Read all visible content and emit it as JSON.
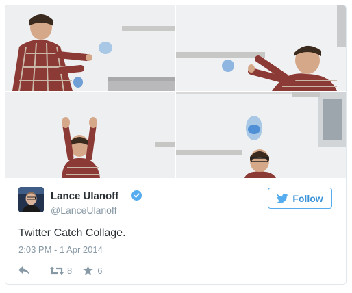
{
  "collage": {
    "photos": [
      {
        "label": "juggling-photo-1"
      },
      {
        "label": "juggling-photo-2"
      },
      {
        "label": "juggling-photo-3"
      },
      {
        "label": "juggling-photo-4"
      }
    ]
  },
  "author": {
    "name": "Lance Ulanoff",
    "handle": "@LanceUlanoff",
    "verified": true,
    "avatar_icon": "avatar-photo"
  },
  "follow_button": {
    "label": "Follow",
    "icon": "twitter-bird-icon",
    "color": "#55acee"
  },
  "tweet": {
    "text": "Twitter Catch Collage.",
    "timestamp": "2:03 PM - 1 Apr 2014"
  },
  "actions": {
    "reply_icon": "reply-icon",
    "retweet_icon": "retweet-icon",
    "retweet_count": "8",
    "favorite_icon": "star-icon",
    "favorite_count": "6"
  },
  "colors": {
    "text": "#292f33",
    "secondary": "#8899a6",
    "accent": "#55acee",
    "verified": "#55acee"
  }
}
